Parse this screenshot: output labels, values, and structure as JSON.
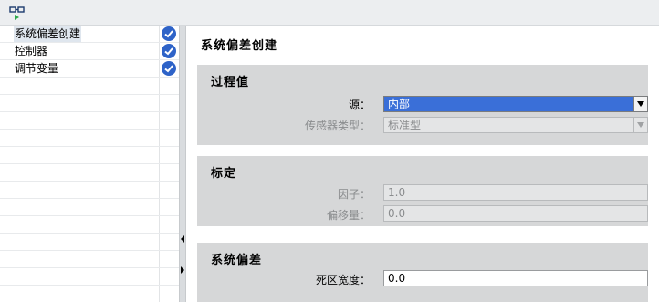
{
  "toolbar": {
    "icon": "network-view-icon"
  },
  "tree": {
    "items": [
      {
        "label": "系统偏差创建",
        "selected": true,
        "status": "check-circle-icon"
      },
      {
        "label": "控制器",
        "selected": false,
        "status": "check-circle-icon"
      },
      {
        "label": "调节变量",
        "selected": false,
        "status": "check-circle-icon"
      }
    ]
  },
  "section": {
    "title": "系统偏差创建"
  },
  "process_value": {
    "title": "过程值",
    "source_label": "源：",
    "source_value": "内部",
    "sensor_type_label": "传感器类型：",
    "sensor_type_value": "标准型"
  },
  "scaling": {
    "title": "标定",
    "factor_label": "因子：",
    "factor_value": "1.0",
    "offset_label": "偏移量：",
    "offset_value": "0.0"
  },
  "deviation": {
    "title": "系统偏差",
    "deadband_label": "死区宽度：",
    "deadband_value": "0.0"
  },
  "colors": {
    "accent": "#3a6fd8",
    "check": "#2e63c8",
    "group_bg": "#d6d7d8"
  }
}
